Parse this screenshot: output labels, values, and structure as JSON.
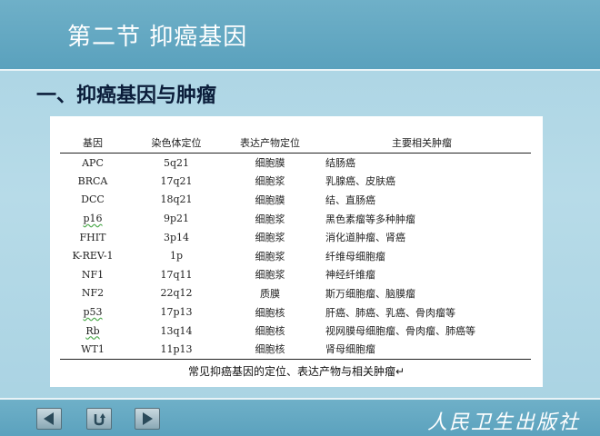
{
  "slide": {
    "title": "第二节    抑癌基因",
    "subtitle": "一、抑癌基因与肿瘤"
  },
  "table": {
    "headers": [
      "基因",
      "染色体定位",
      "表达产物定位",
      "主要相关肿瘤"
    ],
    "rows": [
      [
        "APC",
        "5q21",
        "细胞膜",
        "结肠癌"
      ],
      [
        "BRCA",
        "17q21",
        "细胞浆",
        "乳腺癌、皮肤癌"
      ],
      [
        "DCC",
        "18q21",
        "细胞膜",
        "结、直肠癌"
      ],
      [
        "p16",
        "9p21",
        "细胞浆",
        "黑色素瘤等多种肿瘤"
      ],
      [
        "FHIT",
        "3p14",
        "细胞浆",
        "消化道肿瘤、肾癌"
      ],
      [
        "K-REV-1",
        "1p",
        "细胞浆",
        "纤维母细胞瘤"
      ],
      [
        "NF1",
        "17q11",
        "细胞浆",
        "神经纤维瘤"
      ],
      [
        "NF2",
        "22q12",
        "质膜",
        "斯万细胞瘤、脑膜瘤"
      ],
      [
        "p53",
        "17p13",
        "细胞核",
        "肝癌、肺癌、乳癌、骨肉瘤等"
      ],
      [
        "Rb",
        "13q14",
        "细胞核",
        "视网膜母细胞瘤、骨肉瘤、肺癌等"
      ],
      [
        "WT1",
        "11p13",
        "细胞核",
        "肾母细胞瘤"
      ]
    ],
    "caption": "常见抑癌基因的定位、表达产物与相关肿瘤↵"
  },
  "footer": {
    "publisher": "人民卫生出版社",
    "nav": [
      "previous-icon",
      "return-icon",
      "next-icon"
    ]
  },
  "colors": {
    "background": "#b0d8e6",
    "title_band": "#5fa6c0",
    "title_text": "#ffffff",
    "subtitle_text": "#0b1d3a"
  }
}
